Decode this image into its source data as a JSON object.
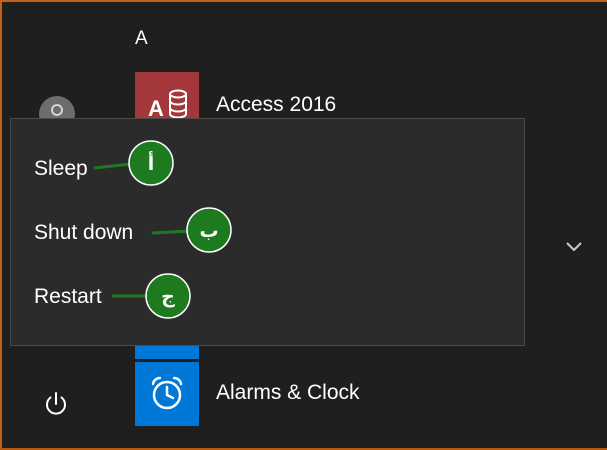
{
  "start_menu": {
    "letter_header": "A",
    "apps": [
      {
        "label": "Access 2016",
        "icon": "access-icon",
        "color": "#a4373a"
      },
      {
        "label": "Alarms & Clock",
        "icon": "alarm-clock-icon",
        "color": "#0078d7"
      }
    ]
  },
  "power_menu": {
    "items": [
      {
        "label": "Sleep",
        "callout": "أ"
      },
      {
        "label": "Shut down",
        "callout": "ب"
      },
      {
        "label": "Restart",
        "callout": "ج"
      }
    ]
  },
  "colors": {
    "callout": "#1e7a1e",
    "menu_bg": "#2b2b2b",
    "accent": "#0078d7"
  }
}
